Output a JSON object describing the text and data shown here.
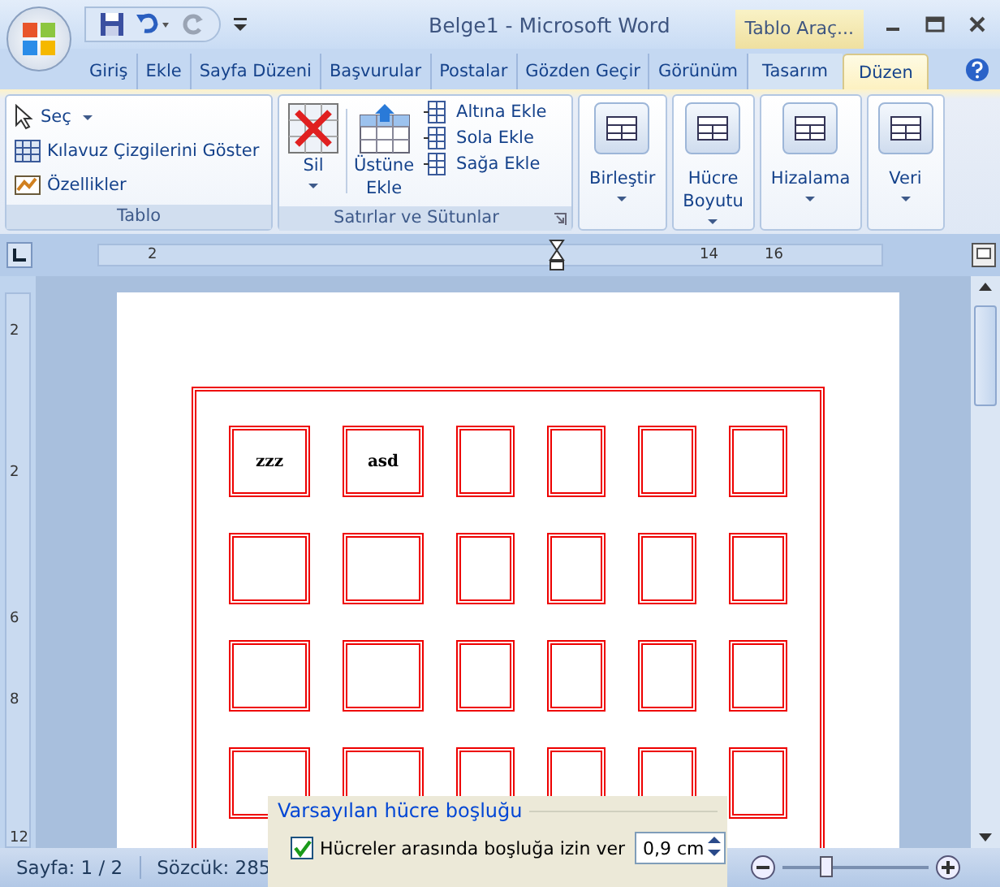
{
  "window": {
    "title": "Belge1 - Microsoft Word",
    "context_label": "Tablo Araç..."
  },
  "tabs": [
    {
      "label": "Giriş",
      "selected": false,
      "kind": "normal"
    },
    {
      "label": "Ekle",
      "selected": false,
      "kind": "normal"
    },
    {
      "label": "Sayfa Düzeni",
      "selected": false,
      "kind": "normal"
    },
    {
      "label": "Başvurular",
      "selected": false,
      "kind": "normal"
    },
    {
      "label": "Postalar",
      "selected": false,
      "kind": "normal"
    },
    {
      "label": "Gözden Geçir",
      "selected": false,
      "kind": "normal"
    },
    {
      "label": "Görünüm",
      "selected": false,
      "kind": "normal"
    },
    {
      "label": "Tasarım",
      "selected": false,
      "kind": "context"
    },
    {
      "label": "Düzen",
      "selected": true,
      "kind": "context"
    }
  ],
  "ribbon": {
    "tablo": {
      "label": "Tablo",
      "items": [
        "Seç",
        "Kılavuz Çizgilerini Göster",
        "Özellikler"
      ]
    },
    "rows_cols": {
      "label": "Satırlar ve Sütunlar",
      "delete": "Sil",
      "insert_above": [
        "Üstüne",
        "Ekle"
      ],
      "small": [
        "Altına Ekle",
        "Sola Ekle",
        "Sağa Ekle"
      ]
    },
    "buttons": [
      {
        "lines": [
          "Birleştir"
        ]
      },
      {
        "lines": [
          "Hücre",
          "Boyutu"
        ]
      },
      {
        "lines": [
          "Hizalama"
        ]
      },
      {
        "lines": [
          "Veri"
        ]
      }
    ]
  },
  "ruler": {
    "labels": [
      "2",
      "14",
      "16"
    ],
    "vertical_labels": [
      "2",
      "2",
      "6",
      "8",
      "12"
    ]
  },
  "table": {
    "rows": [
      {
        "cells": [
          {
            "text": "zzz"
          },
          {
            "text": "asd"
          },
          {},
          {},
          {},
          {}
        ]
      },
      {
        "cells": [
          {},
          {},
          {},
          {},
          {},
          {}
        ]
      },
      {
        "cells": [
          {},
          {},
          {},
          {},
          {},
          {}
        ]
      },
      {
        "cells": [
          {},
          {},
          {},
          {},
          {},
          {}
        ]
      }
    ]
  },
  "dialog": {
    "legend": "Varsayılan hücre boşluğu",
    "checkbox": {
      "label": "Hücreler arasında boşluğa izin ver",
      "checked": true
    },
    "value": "0,9 cm"
  },
  "status_bar": {
    "page": "Sayfa: 1 / 2",
    "words": "Sözcük: 285",
    "zoom": {
      "level": 0.3
    }
  }
}
